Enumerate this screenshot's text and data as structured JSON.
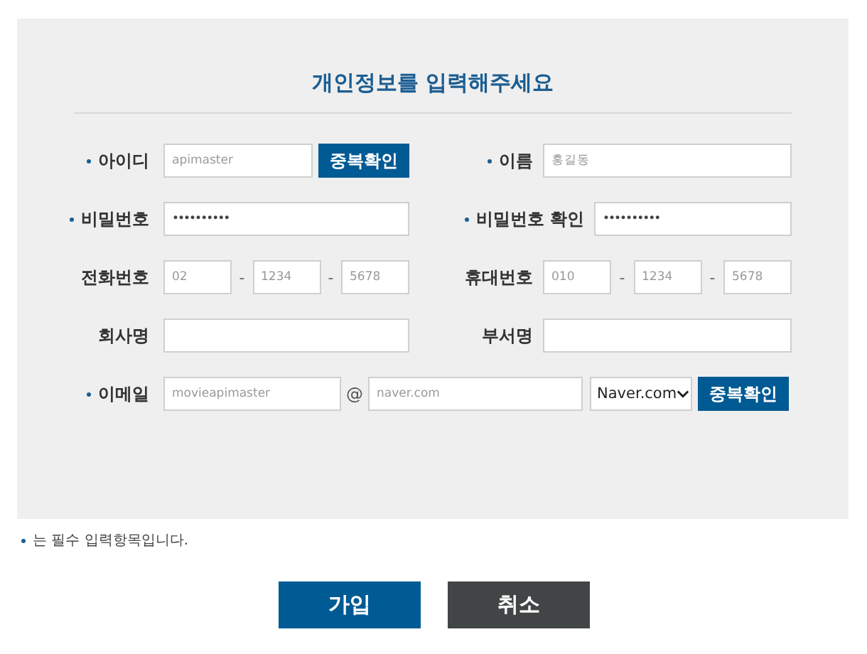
{
  "title": "개인정보를 입력해주세요",
  "rows": [
    {
      "fields": [
        {
          "kind": "text",
          "label": "아이디",
          "required": true,
          "placeholder": "apimaster",
          "button": "중복확인"
        },
        {
          "kind": "text",
          "label": "이름",
          "required": true,
          "placeholder": "홍길동"
        }
      ]
    },
    {
      "fields": [
        {
          "kind": "password",
          "label": "비밀번호",
          "required": true,
          "value": "••••••••••"
        },
        {
          "kind": "password",
          "label": "비밀번호 확인",
          "required": true,
          "value": "••••••••••"
        }
      ]
    },
    {
      "fields": [
        {
          "kind": "phone",
          "label": "전화번호",
          "required": false,
          "parts": [
            {
              "placeholder": "02"
            },
            {
              "placeholder": "1234"
            },
            {
              "placeholder": "5678"
            }
          ],
          "separator": "-"
        },
        {
          "kind": "phone",
          "label": "휴대번호",
          "required": false,
          "parts": [
            {
              "placeholder": "010"
            },
            {
              "placeholder": "1234"
            },
            {
              "placeholder": "5678"
            }
          ],
          "separator": "-"
        }
      ]
    },
    {
      "fields": [
        {
          "kind": "text",
          "label": "회사명",
          "required": false
        },
        {
          "kind": "text",
          "label": "부서명",
          "required": false
        }
      ]
    },
    {
      "fields": [
        {
          "kind": "email",
          "label": "이메일",
          "required": true,
          "local_placeholder": "movieapimaster",
          "at": "@",
          "domain_placeholder": "naver.com",
          "select": "Naver.com",
          "button": "중복확인"
        }
      ]
    }
  ],
  "note": {
    "required_marker": true,
    "text": "는 필수 입력항목입니다."
  },
  "buttons": [
    {
      "label": "가입",
      "kind": "primary"
    },
    {
      "label": "취소",
      "kind": "secondary"
    }
  ]
}
